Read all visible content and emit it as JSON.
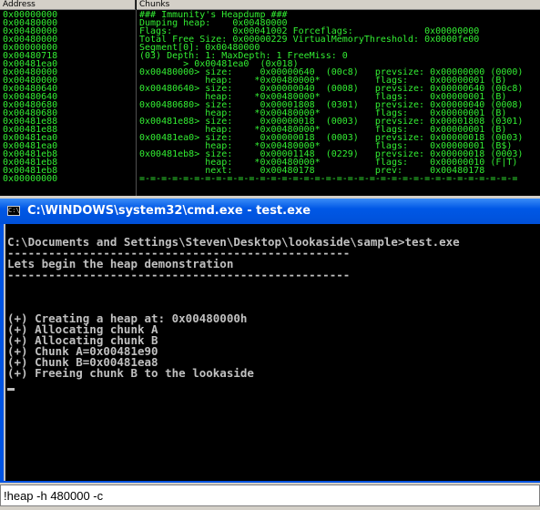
{
  "dump": {
    "headers": {
      "address": "Address",
      "chunks": "Chunks"
    },
    "addresses": [
      "0x00000000",
      "0x00480000",
      "0x00480000",
      "0x00480000",
      "0x00000000",
      "0x00480718",
      "0x00481ea0",
      "0x00480000",
      "0x00480000",
      "0x00480640",
      "0x00480640",
      "0x00480680",
      "0x00480680",
      "0x00481e88",
      "0x00481e88",
      "0x00481ea0",
      "0x00481ea0",
      "0x00481eb8",
      "0x00481eb8",
      "0x00481eb8",
      "0x00000000"
    ],
    "chunks": [
      "### Immunity's Heapdump ###",
      "Dumping heap:    0x00480000",
      "Flags:           0x00041002 Forceflags:             0x00000000",
      "Total Free Size: 0x00000229 VirtualMemoryThreshold: 0x0000fe00",
      "Segment[0]: 0x00480000",
      "(03) Depth: 1: MaxDepth: 1 FreeMiss: 0",
      "        > 0x00481ea0  (0x018)",
      "0x00480000> size:     0x00000640  (00c8)   prevsize: 0x00000000 (0000)",
      "            heap:    *0x00480000*          flags:    0x00000001 (B)",
      "0x00480640> size:     0x00000040  (0008)   prevsize: 0x00000640 (00c8)",
      "            heap:    *0x00480000*          flags:    0x00000001 (B)",
      "0x00480680> size:     0x00001808  (0301)   prevsize: 0x00000040 (0008)",
      "            heap:    *0x00480000*          flags:    0x00000001 (B)",
      "0x00481e88> size:     0x00000018  (0003)   prevsize: 0x00001808 (0301)",
      "            heap:    *0x00480000*          flags:    0x00000001 (B)",
      "0x00481ea0> size:     0x00000018  (0003)   prevsize: 0x00000018 (0003)",
      "            heap:    *0x00480000*          flags:    0x00000001 (B$)",
      "0x00481eb8> size:     0x00001148  (0229)   prevsize: 0x00000018 (0003)",
      "            heap:    *0x00480000*          flags:    0x00000010 (F|T)",
      "            next:     0x00480178           prev:     0x00480178",
      "=-=-=-=-=-=-=-=-=-=-=-=-=-=-=-=-=-=-=-=-=-=-=-=-=-=-=-=-=-=-=-=-=-=-="
    ]
  },
  "cmd": {
    "title": "C:\\WINDOWS\\system32\\cmd.exe - test.exe",
    "icon_text": "C:\\",
    "lines": [
      "C:\\Documents and Settings\\Steven\\Desktop\\lookaside\\sample>test.exe",
      "--------------------------------------------------",
      "Lets begin the heap demonstration",
      "--------------------------------------------------",
      "",
      "",
      "",
      "(+) Creating a heap at: 0x00480000h",
      "(+) Allocating chunk A",
      "(+) Allocating chunk B",
      "(+) Chunk A=0x00481e90",
      "(+) Chunk B=0x00481ea8",
      "(+) Freeing chunk B to the lookaside"
    ]
  },
  "command_bar": {
    "value": "!heap -h 480000 -c"
  },
  "colors": {
    "dump_text": "#33ee33",
    "console_text": "#c0c0c0",
    "title_bar": "#0058e6"
  }
}
